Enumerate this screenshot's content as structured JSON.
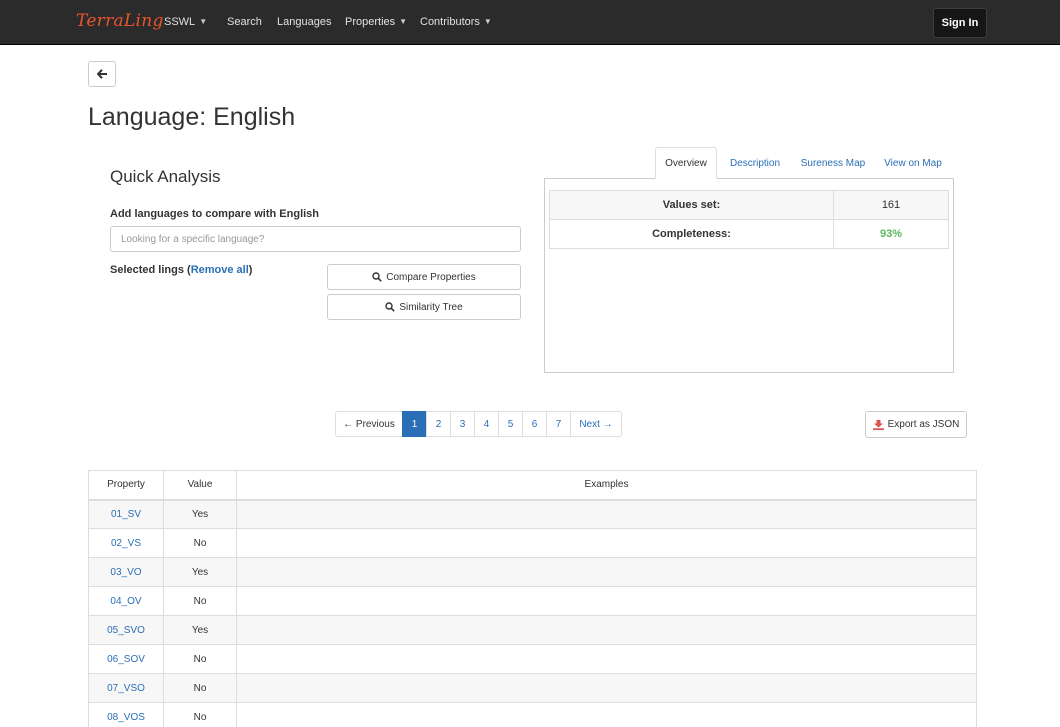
{
  "navbar": {
    "brand": "TerraLing",
    "items": [
      {
        "label": "SSWL",
        "dropdown": true
      },
      {
        "label": "Search",
        "dropdown": false
      },
      {
        "label": "Languages",
        "dropdown": false
      },
      {
        "label": "Properties",
        "dropdown": true
      },
      {
        "label": "Contributors",
        "dropdown": true
      }
    ],
    "sign_in": "Sign In"
  },
  "page": {
    "title": "Language: English"
  },
  "quick_analysis": {
    "title": "Quick Analysis",
    "compare_label": "Add languages to compare with English",
    "search_placeholder": "Looking for a specific language?",
    "selected_prefix": "Selected lings (",
    "remove_all": "Remove all",
    "selected_suffix": ")",
    "compare_button": "Compare Properties",
    "tree_button": "Similarity Tree"
  },
  "tabs": [
    {
      "label": "Overview",
      "active": true
    },
    {
      "label": "Description",
      "active": false
    },
    {
      "label": "Sureness Map",
      "active": false
    },
    {
      "label": "View on Map",
      "active": false
    }
  ],
  "overview": {
    "rows": [
      {
        "label": "Values set:",
        "value": "161"
      },
      {
        "label": "Completeness:",
        "value": "93%"
      }
    ]
  },
  "pagination": {
    "previous": "← Previous",
    "pages": [
      "1",
      "2",
      "3",
      "4",
      "5",
      "6",
      "7"
    ],
    "active_page": "1",
    "next": "Next →"
  },
  "export_button": "Export as JSON",
  "table": {
    "headers": [
      "Property",
      "Value",
      "Examples"
    ],
    "rows": [
      {
        "property": "01_SV",
        "value": "Yes",
        "examples": ""
      },
      {
        "property": "02_VS",
        "value": "No",
        "examples": ""
      },
      {
        "property": "03_VO",
        "value": "Yes",
        "examples": ""
      },
      {
        "property": "04_OV",
        "value": "No",
        "examples": ""
      },
      {
        "property": "05_SVO",
        "value": "Yes",
        "examples": ""
      },
      {
        "property": "06_SOV",
        "value": "No",
        "examples": ""
      },
      {
        "property": "07_VSO",
        "value": "No",
        "examples": ""
      },
      {
        "property": "08_VOS",
        "value": "No",
        "examples": ""
      }
    ]
  },
  "colors": {
    "brand": "#e8542e",
    "link": "#2a6fb6",
    "success": "#5cb85c",
    "navbar": "#2b2b2b"
  }
}
